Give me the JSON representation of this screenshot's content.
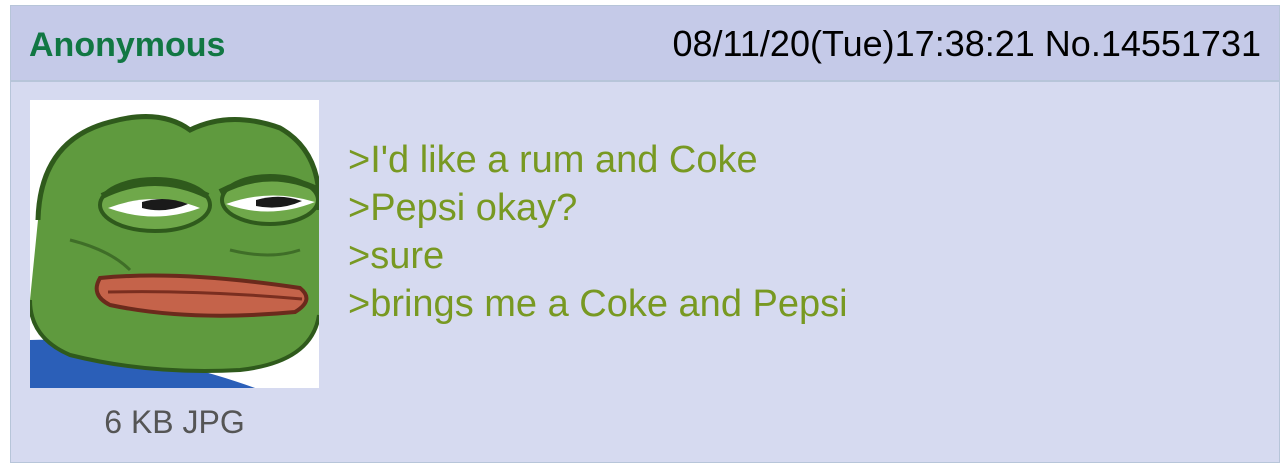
{
  "post": {
    "name": "Anonymous",
    "datetime": "08/11/20(Tue)17:38:21",
    "post_number": "No.14551731",
    "file_info": "6 KB JPG",
    "thumbnail_icon": "pepe-frog-image",
    "lines": [
      ">I'd like a rum and Coke",
      ">Pepsi okay?",
      ">sure",
      ">brings me a Coke and Pepsi"
    ]
  },
  "colors": {
    "post_bg": "#d6daf0",
    "header_bg": "#c5cae8",
    "name": "#117743",
    "greentext": "#789922"
  }
}
